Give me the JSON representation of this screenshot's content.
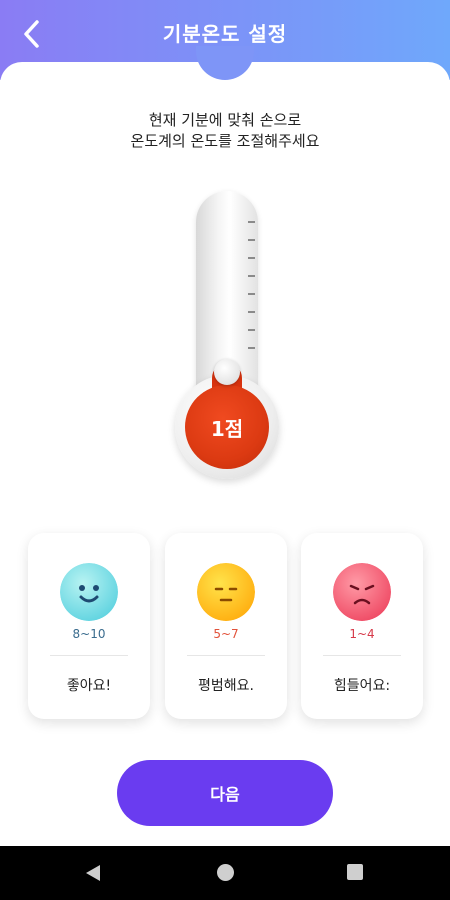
{
  "header": {
    "title": "기분온도 설정"
  },
  "instruction": {
    "line1": "현재 기분에 맞춰 손으로",
    "line2": "온도계의 온도를 조절해주세요"
  },
  "thermometer": {
    "score_label": "1점",
    "level": 0.0
  },
  "moods": [
    {
      "icon": "happy-face-icon",
      "range": "8~10",
      "label": "좋아요!",
      "range_color": "#3a6c8e"
    },
    {
      "icon": "neutral-face-icon",
      "range": "5~7",
      "label": "평범해요.",
      "range_color": "#e2523a"
    },
    {
      "icon": "sad-face-icon",
      "range": "1~4",
      "label": "힘들어요:",
      "range_color": "#d63a4a"
    }
  ],
  "footer": {
    "next_label": "다음"
  },
  "colors": {
    "accent": "#6a3cf0",
    "thermometer": "#dc3a12"
  }
}
